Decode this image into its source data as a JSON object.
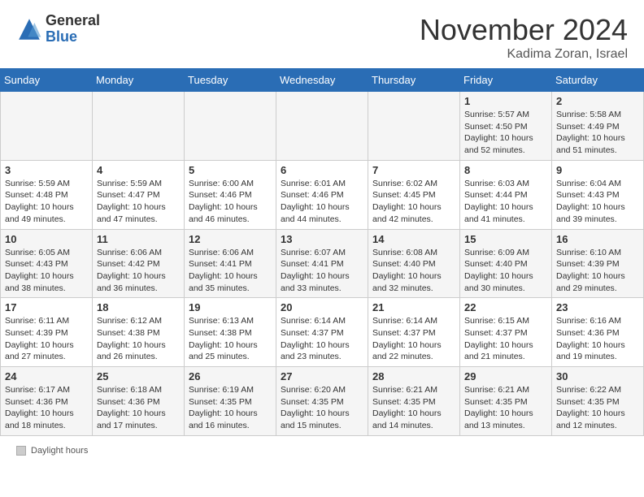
{
  "header": {
    "logo_general": "General",
    "logo_blue": "Blue",
    "month_title": "November 2024",
    "location": "Kadima Zoran, Israel"
  },
  "days_of_week": [
    "Sunday",
    "Monday",
    "Tuesday",
    "Wednesday",
    "Thursday",
    "Friday",
    "Saturday"
  ],
  "footer": {
    "daylight_label": "Daylight hours"
  },
  "weeks": [
    [
      {
        "day": "",
        "info": ""
      },
      {
        "day": "",
        "info": ""
      },
      {
        "day": "",
        "info": ""
      },
      {
        "day": "",
        "info": ""
      },
      {
        "day": "",
        "info": ""
      },
      {
        "day": "1",
        "info": "Sunrise: 5:57 AM\nSunset: 4:50 PM\nDaylight: 10 hours and 52 minutes."
      },
      {
        "day": "2",
        "info": "Sunrise: 5:58 AM\nSunset: 4:49 PM\nDaylight: 10 hours and 51 minutes."
      }
    ],
    [
      {
        "day": "3",
        "info": "Sunrise: 5:59 AM\nSunset: 4:48 PM\nDaylight: 10 hours and 49 minutes."
      },
      {
        "day": "4",
        "info": "Sunrise: 5:59 AM\nSunset: 4:47 PM\nDaylight: 10 hours and 47 minutes."
      },
      {
        "day": "5",
        "info": "Sunrise: 6:00 AM\nSunset: 4:46 PM\nDaylight: 10 hours and 46 minutes."
      },
      {
        "day": "6",
        "info": "Sunrise: 6:01 AM\nSunset: 4:46 PM\nDaylight: 10 hours and 44 minutes."
      },
      {
        "day": "7",
        "info": "Sunrise: 6:02 AM\nSunset: 4:45 PM\nDaylight: 10 hours and 42 minutes."
      },
      {
        "day": "8",
        "info": "Sunrise: 6:03 AM\nSunset: 4:44 PM\nDaylight: 10 hours and 41 minutes."
      },
      {
        "day": "9",
        "info": "Sunrise: 6:04 AM\nSunset: 4:43 PM\nDaylight: 10 hours and 39 minutes."
      }
    ],
    [
      {
        "day": "10",
        "info": "Sunrise: 6:05 AM\nSunset: 4:43 PM\nDaylight: 10 hours and 38 minutes."
      },
      {
        "day": "11",
        "info": "Sunrise: 6:06 AM\nSunset: 4:42 PM\nDaylight: 10 hours and 36 minutes."
      },
      {
        "day": "12",
        "info": "Sunrise: 6:06 AM\nSunset: 4:41 PM\nDaylight: 10 hours and 35 minutes."
      },
      {
        "day": "13",
        "info": "Sunrise: 6:07 AM\nSunset: 4:41 PM\nDaylight: 10 hours and 33 minutes."
      },
      {
        "day": "14",
        "info": "Sunrise: 6:08 AM\nSunset: 4:40 PM\nDaylight: 10 hours and 32 minutes."
      },
      {
        "day": "15",
        "info": "Sunrise: 6:09 AM\nSunset: 4:40 PM\nDaylight: 10 hours and 30 minutes."
      },
      {
        "day": "16",
        "info": "Sunrise: 6:10 AM\nSunset: 4:39 PM\nDaylight: 10 hours and 29 minutes."
      }
    ],
    [
      {
        "day": "17",
        "info": "Sunrise: 6:11 AM\nSunset: 4:39 PM\nDaylight: 10 hours and 27 minutes."
      },
      {
        "day": "18",
        "info": "Sunrise: 6:12 AM\nSunset: 4:38 PM\nDaylight: 10 hours and 26 minutes."
      },
      {
        "day": "19",
        "info": "Sunrise: 6:13 AM\nSunset: 4:38 PM\nDaylight: 10 hours and 25 minutes."
      },
      {
        "day": "20",
        "info": "Sunrise: 6:14 AM\nSunset: 4:37 PM\nDaylight: 10 hours and 23 minutes."
      },
      {
        "day": "21",
        "info": "Sunrise: 6:14 AM\nSunset: 4:37 PM\nDaylight: 10 hours and 22 minutes."
      },
      {
        "day": "22",
        "info": "Sunrise: 6:15 AM\nSunset: 4:37 PM\nDaylight: 10 hours and 21 minutes."
      },
      {
        "day": "23",
        "info": "Sunrise: 6:16 AM\nSunset: 4:36 PM\nDaylight: 10 hours and 19 minutes."
      }
    ],
    [
      {
        "day": "24",
        "info": "Sunrise: 6:17 AM\nSunset: 4:36 PM\nDaylight: 10 hours and 18 minutes."
      },
      {
        "day": "25",
        "info": "Sunrise: 6:18 AM\nSunset: 4:36 PM\nDaylight: 10 hours and 17 minutes."
      },
      {
        "day": "26",
        "info": "Sunrise: 6:19 AM\nSunset: 4:35 PM\nDaylight: 10 hours and 16 minutes."
      },
      {
        "day": "27",
        "info": "Sunrise: 6:20 AM\nSunset: 4:35 PM\nDaylight: 10 hours and 15 minutes."
      },
      {
        "day": "28",
        "info": "Sunrise: 6:21 AM\nSunset: 4:35 PM\nDaylight: 10 hours and 14 minutes."
      },
      {
        "day": "29",
        "info": "Sunrise: 6:21 AM\nSunset: 4:35 PM\nDaylight: 10 hours and 13 minutes."
      },
      {
        "day": "30",
        "info": "Sunrise: 6:22 AM\nSunset: 4:35 PM\nDaylight: 10 hours and 12 minutes."
      }
    ]
  ]
}
